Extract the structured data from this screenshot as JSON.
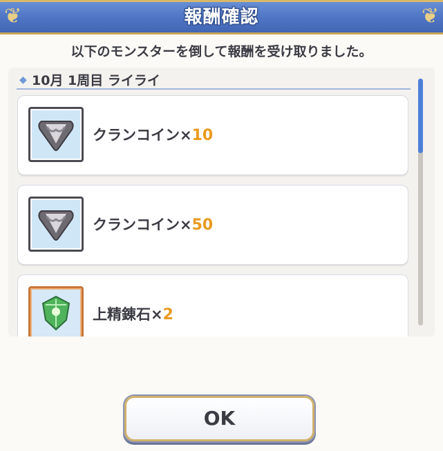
{
  "dialog": {
    "title": "報酬確認",
    "message": "以下のモンスターを倒して報酬を受け取りました。"
  },
  "section": {
    "title": "10月 1周目 ライライ"
  },
  "rewards": [
    {
      "name": "クランコイン×",
      "count": "10",
      "icon": "clan-coin-icon"
    },
    {
      "name": "クランコイン×",
      "count": "50",
      "icon": "clan-coin-icon"
    },
    {
      "name": "上精錬石×",
      "count": "2",
      "icon": "refining-stone-icon"
    }
  ],
  "buttons": {
    "ok": "OK"
  },
  "colors": {
    "title_bar": "#4f75c4",
    "count_accent": "#ea9a1f",
    "scroll_thumb": "#4d7fd8"
  }
}
